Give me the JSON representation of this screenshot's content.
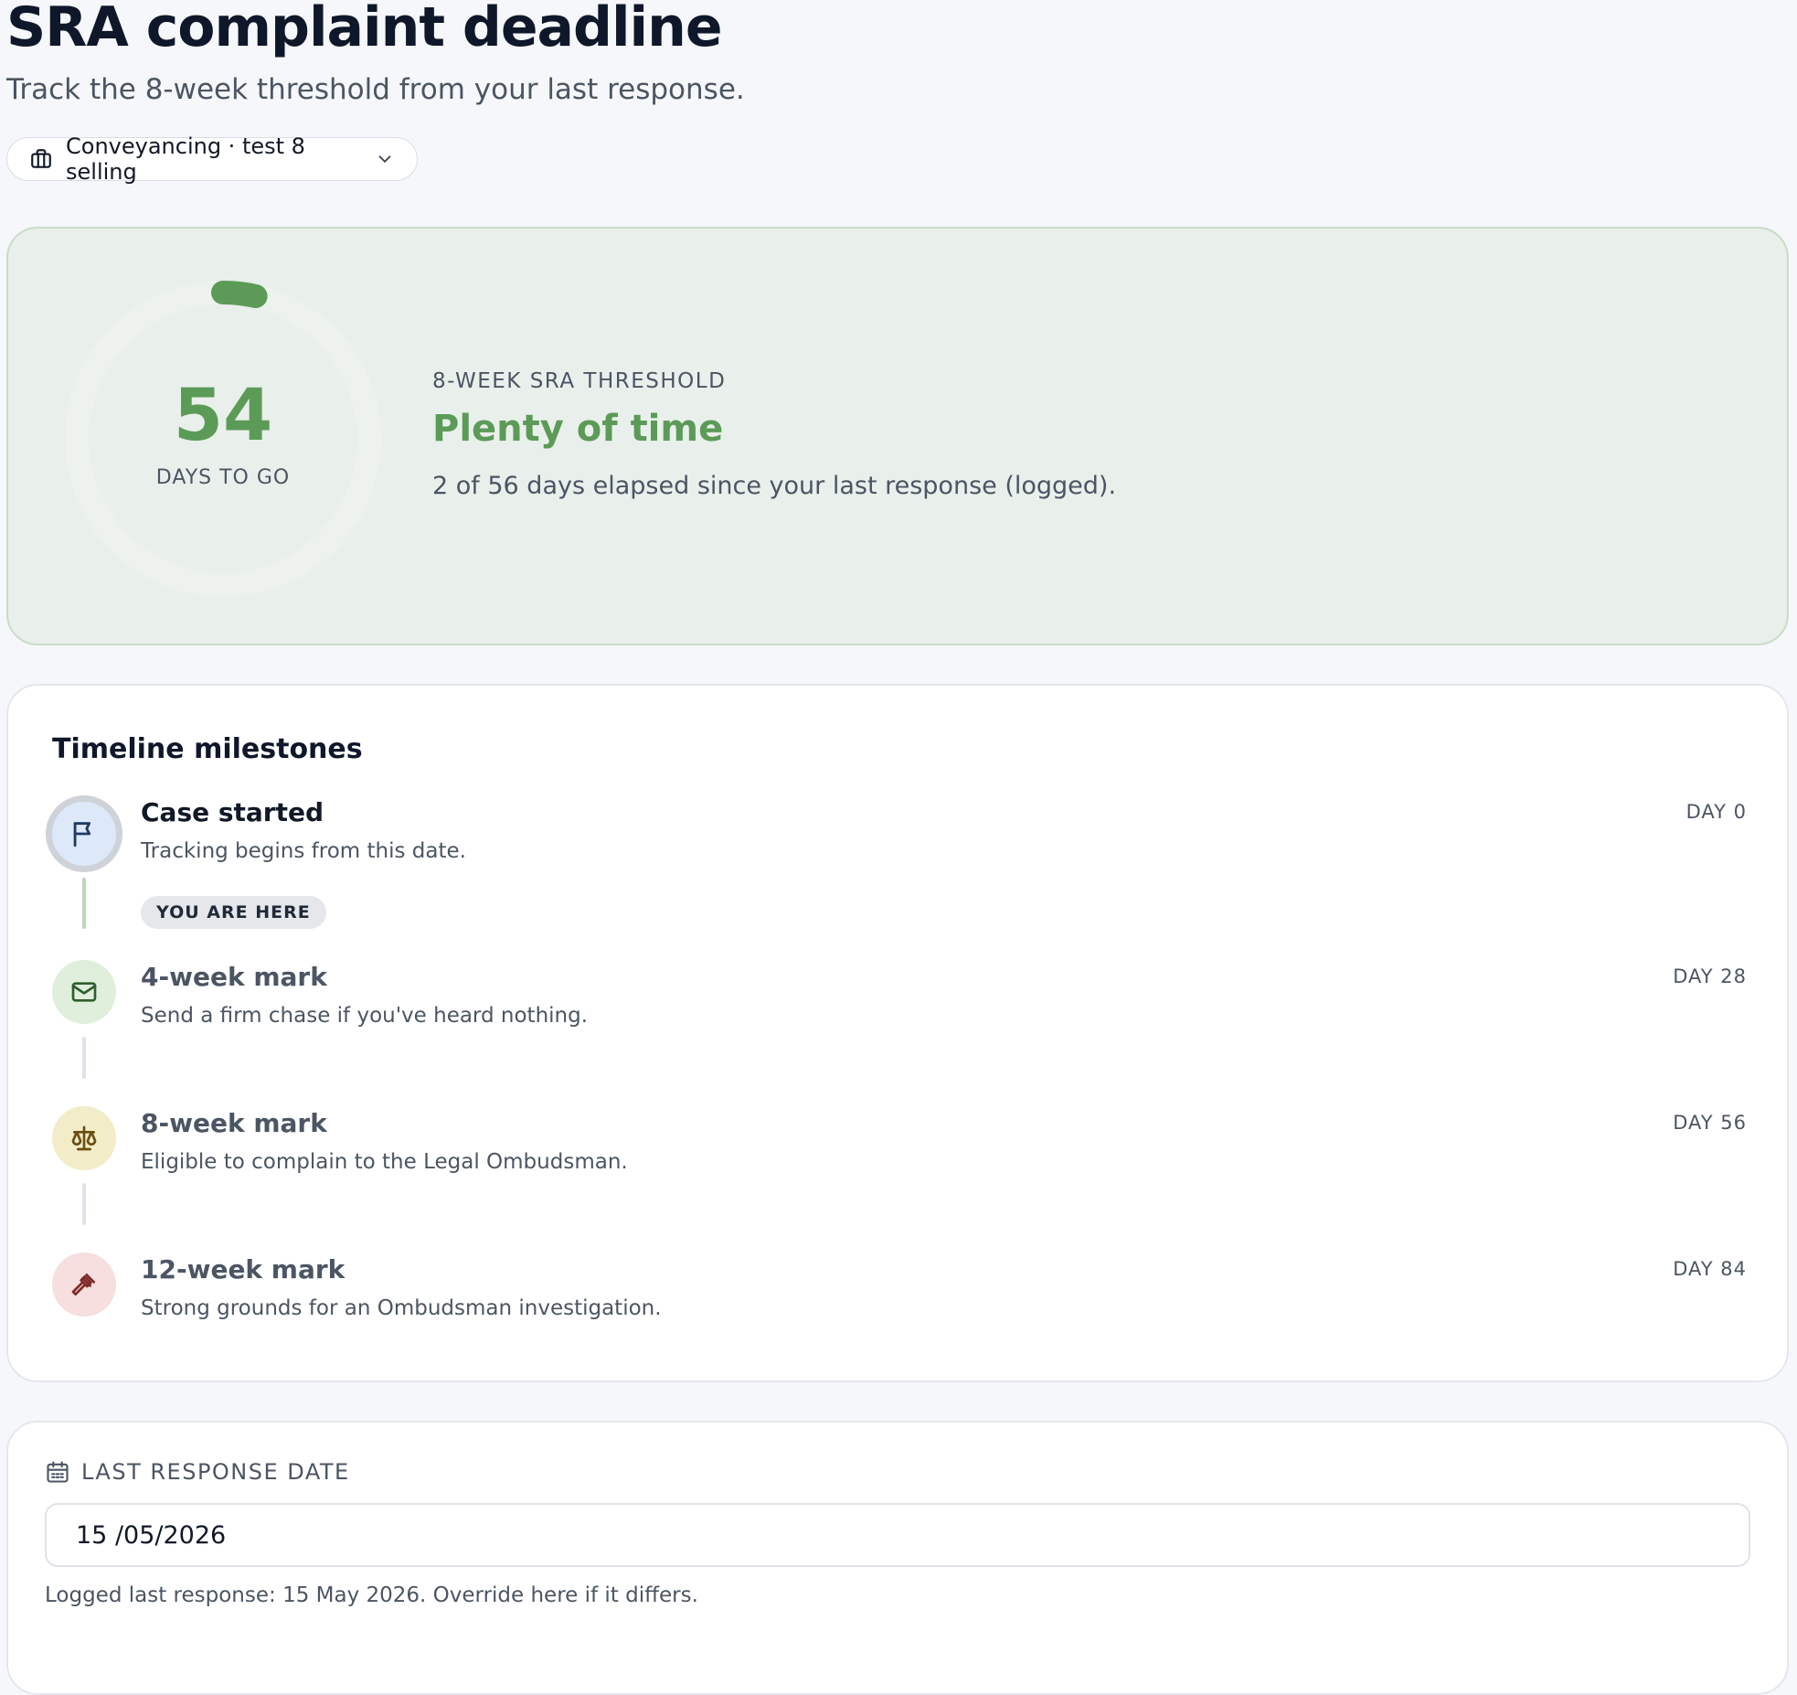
{
  "header": {
    "title": "SRA complaint deadline",
    "subtitle": "Track the 8-week threshold from your last response."
  },
  "case_selector": {
    "label": "Conveyancing · test 8 selling",
    "icon": "briefcase-icon"
  },
  "status": {
    "days_remaining": "54",
    "days_label": "DAYS TO GO",
    "threshold_label": "8-WEEK SRA THRESHOLD",
    "status_text": "Plenty of time",
    "detail": "2 of 56 days elapsed since your last response (logged).",
    "days_elapsed": 2,
    "days_total": 56,
    "accent_color": "#5b9b57"
  },
  "timeline": {
    "title": "Timeline milestones",
    "milestones": [
      {
        "name": "Case started",
        "description": "Tracking begins from this date.",
        "day": "DAY 0",
        "icon": "flag-icon",
        "badge": "YOU ARE HERE"
      },
      {
        "name": "4-week mark",
        "description": "Send a firm chase if you've heard nothing.",
        "day": "DAY 28",
        "icon": "mail-icon"
      },
      {
        "name": "8-week mark",
        "description": "Eligible to complain to the Legal Ombudsman.",
        "day": "DAY 56",
        "icon": "scales-icon"
      },
      {
        "name": "12-week mark",
        "description": "Strong grounds for an Ombudsman investigation.",
        "day": "DAY 84",
        "icon": "gavel-icon"
      }
    ]
  },
  "last_response": {
    "label": "LAST RESPONSE DATE",
    "value": "15 /05/2026",
    "hint": "Logged last response: 15 May 2026. Override here if it differs."
  }
}
